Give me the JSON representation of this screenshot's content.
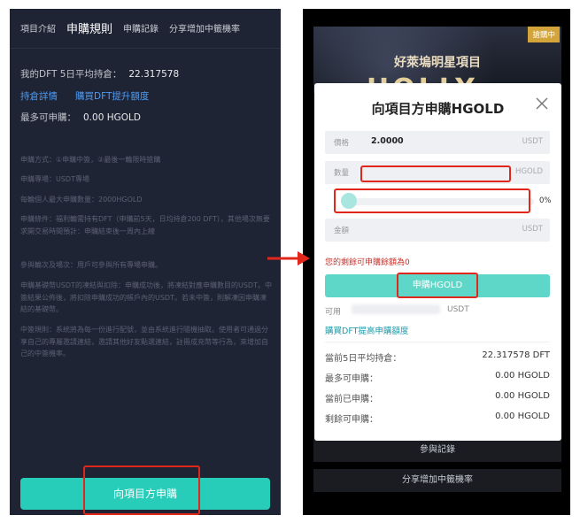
{
  "left": {
    "tabs": [
      "項目介紹",
      "申購規則",
      "申購記錄",
      "分享增加中籤機率"
    ],
    "holding_label": "我的DFT 5日平均持倉：",
    "holding_value": "22.317578",
    "link_details": "持倉詳情",
    "link_buy": "購買DFT提升額度",
    "max_label": "最多可申購：",
    "max_value": "0.00 HGOLD",
    "rules": [
      "申購方式：①申購中簽，②最後一輪限時搶購",
      "申購專場：USDT專場",
      "每輪個人最大申購數量：2000HGOLD",
      "申購條件：福利輪需持有DFT（申購前5天，日均持倉200 DFT），其他場次無要求開交易時間預計：申購結束後一周內上線",
      "參與輪次及場次：用戶可參與所有專場申購。",
      "申購基礎幣USDT的凍結與扣除：申購成功後，將凍結對應申購數目的USDT。中簽結果公佈後，將扣除申購成功的帳戶內的USDT。若未中簽，則解凍因申購凍結的基礎幣。",
      "中簽規則：系統將為每一份進行配號，並由系統進行隨機抽取。使用者可通過分享自己的專屬邀請連結，邀請其他好友點選連結，註冊成充幣等行為，來增加自己的中簽機率。"
    ],
    "cta": "向項目方申購"
  },
  "right": {
    "banner_title": "好萊塢明星項目",
    "banner_big": "HOLLY GOLD",
    "badge": "搶購中",
    "modal": {
      "title": "向項目方申購HGOLD",
      "price_label": "價格",
      "price_value": "2.0000",
      "price_unit": "USDT",
      "qty_label": "數量",
      "qty_unit": "HGOLD",
      "slider_pct": "0%",
      "slider_value": 0,
      "amount_label": "金額",
      "amount_unit": "USDT",
      "warning": "您的剩餘可申購餘額為0",
      "button": "申購HGOLD",
      "avail_label": "可用",
      "avail_unit": "USDT",
      "buy_link": "購買DFT提高申購額度",
      "stats": [
        {
          "k": "當前5日平均持倉：",
          "v": "22.317578 DFT"
        },
        {
          "k": "最多可申購：",
          "v": "0.00 HGOLD"
        },
        {
          "k": "當前已申購：",
          "v": "0.00 HGOLD"
        },
        {
          "k": "剩餘可申購：",
          "v": "0.00 HGOLD"
        }
      ]
    },
    "btn_record": "參與記錄",
    "btn_share": "分享增加中籤機率"
  },
  "colors": {
    "accent": "#27cdb9",
    "link": "#4d9cf5",
    "annotation": "#e1261c",
    "warning": "#c4332c"
  }
}
